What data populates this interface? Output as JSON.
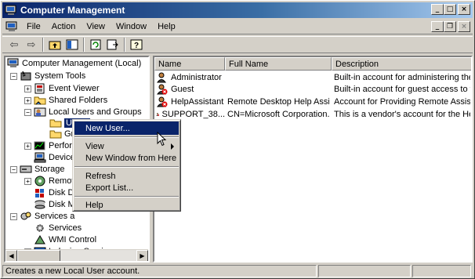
{
  "window": {
    "title": "Computer Management",
    "controls": {
      "minimize": "_",
      "maximize": "□",
      "close": "×"
    }
  },
  "menu": {
    "items": [
      "File",
      "Action",
      "View",
      "Window",
      "Help"
    ],
    "mdi_controls": {
      "minimize": "_",
      "restore": "❐",
      "close": "×"
    }
  },
  "toolbar": {
    "back": "⇦",
    "forward": "⇨"
  },
  "tree": {
    "root": "Computer Management (Local)",
    "system_tools": "System Tools",
    "event_viewer": "Event Viewer",
    "shared_folders": "Shared Folders",
    "local_users": "Local Users and Groups",
    "users": "Users",
    "groups": "Gr",
    "performance": "Perfor",
    "device_manager": "Device",
    "storage": "Storage",
    "removable": "Remov",
    "disk_defrag": "Disk D",
    "disk_mgmt": "Disk M",
    "services_apps": "Services a",
    "services": "Services",
    "wmi": "WMI Control",
    "indexing": "Indexing Service",
    "exp_minus": "−",
    "exp_plus": "+"
  },
  "list": {
    "columns": [
      "Name",
      "Full Name",
      "Description"
    ],
    "rows": [
      {
        "name": "Administrator",
        "full_name": "",
        "description": "Built-in account for administering the..."
      },
      {
        "name": "Guest",
        "full_name": "",
        "description": "Built-in account for guest access to t..."
      },
      {
        "name": "HelpAssistant",
        "full_name": "Remote Desktop Help Assi...",
        "description": "Account for Providing Remote Assist..."
      },
      {
        "name": "SUPPORT_38...",
        "full_name": "CN=Microsoft Corporation...",
        "description": "This is a vendor's account for the He..."
      }
    ]
  },
  "context_menu": {
    "new_user": "New User...",
    "view": "View",
    "new_window": "New Window from Here",
    "refresh": "Refresh",
    "export": "Export List...",
    "help": "Help"
  },
  "status": {
    "text": "Creates a new Local User account."
  },
  "colors": {
    "titlebar_start": "#0a246a",
    "titlebar_end": "#a6caf0",
    "highlight": "#0a246a",
    "chrome": "#d4d0c8"
  }
}
